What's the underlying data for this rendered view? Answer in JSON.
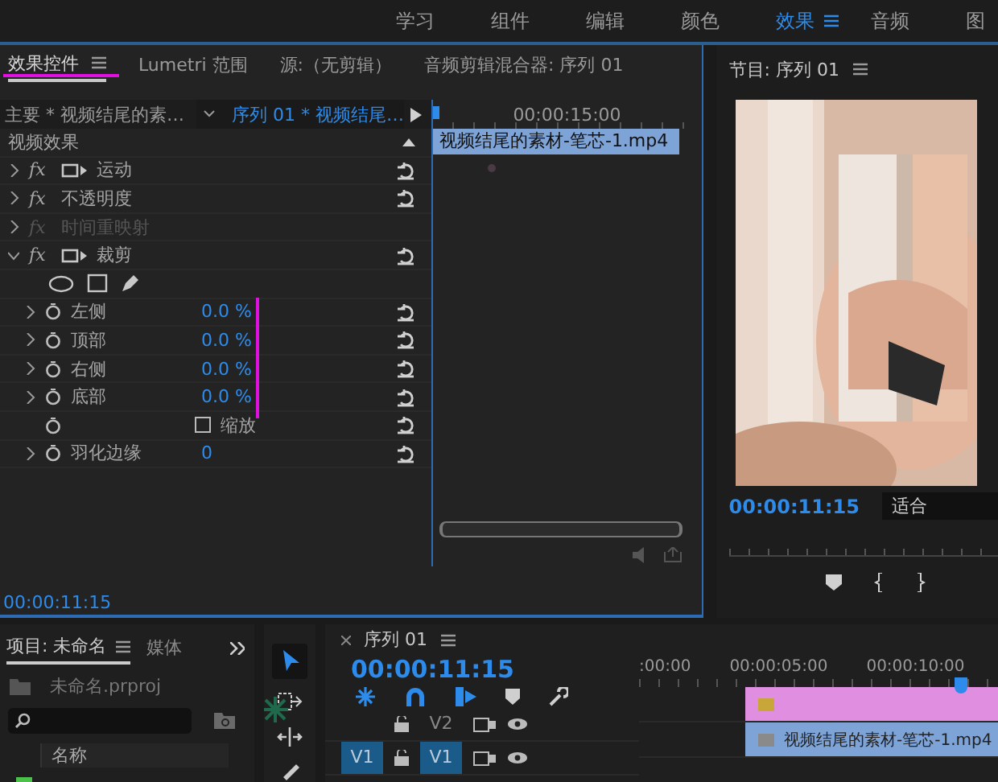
{
  "workspaces": [
    {
      "label": "学习",
      "selected": false
    },
    {
      "label": "组件",
      "selected": false
    },
    {
      "label": "编辑",
      "selected": false
    },
    {
      "label": "颜色",
      "selected": false
    },
    {
      "label": "效果",
      "selected": true
    },
    {
      "label": "音频",
      "selected": false
    },
    {
      "label": "图",
      "selected": false
    }
  ],
  "effect_controls": {
    "tabs": [
      {
        "label": "效果控件",
        "selected": true
      },
      {
        "label": "Lumetri 范围",
        "selected": false
      },
      {
        "label": "源:（无剪辑）",
        "selected": false
      },
      {
        "label": "音频剪辑混合器: 序列 01",
        "selected": false
      }
    ],
    "master_clip": "主要 * 视频结尾的素…",
    "sequence_clip": "序列 01 * 视频结尾…",
    "section": "视频效果",
    "effects": [
      {
        "badge": "fx",
        "name": "运动",
        "transform": true,
        "expanded": false,
        "disabled": false
      },
      {
        "badge": "fx",
        "name": "不透明度",
        "transform": false,
        "expanded": false,
        "disabled": false
      },
      {
        "badge": "fx",
        "name": "时间重映射",
        "transform": false,
        "expanded": false,
        "disabled": true
      },
      {
        "badge": "fx",
        "name": "裁剪",
        "transform": true,
        "expanded": true,
        "disabled": false,
        "properties": [
          {
            "kind": "value",
            "name": "左侧",
            "value": "0.0 %"
          },
          {
            "kind": "value",
            "name": "顶部",
            "value": "0.0 %"
          },
          {
            "kind": "value",
            "name": "右侧",
            "value": "0.0 %"
          },
          {
            "kind": "value",
            "name": "底部",
            "value": "0.0 %"
          },
          {
            "kind": "checkbox",
            "label": "缩放",
            "checked": false
          },
          {
            "kind": "value",
            "name": "羽化边缘",
            "value": "0"
          }
        ]
      }
    ],
    "ruler_time": "00:00:15:00",
    "clip": "视频结尾的素材-笔芯-1.mp4",
    "timecode": "00:00:11:15"
  },
  "program": {
    "title": "节目: 序列 01",
    "timecode": "00:00:11:15",
    "fit": "适合"
  },
  "project": {
    "tabs": [
      {
        "label": "项目: 未命名",
        "selected": true
      },
      {
        "label": "媒体",
        "selected": false
      }
    ],
    "file": "未命名.prproj",
    "columns": [
      "名称"
    ]
  },
  "timeline": {
    "title": "序列 01",
    "timecode": "00:00:11:15",
    "ruler": [
      ":00:00",
      "00:00:05:00",
      "00:00:10:00"
    ],
    "tracks": [
      {
        "label": "V2",
        "targeted": false,
        "clip": {
          "color": "#e08ee0"
        }
      },
      {
        "source": "V1",
        "label": "V1",
        "targeted": true,
        "clip": {
          "color": "#7ea3d6",
          "name": "视频结尾的素材-笔芯-1.mp4"
        }
      }
    ]
  }
}
